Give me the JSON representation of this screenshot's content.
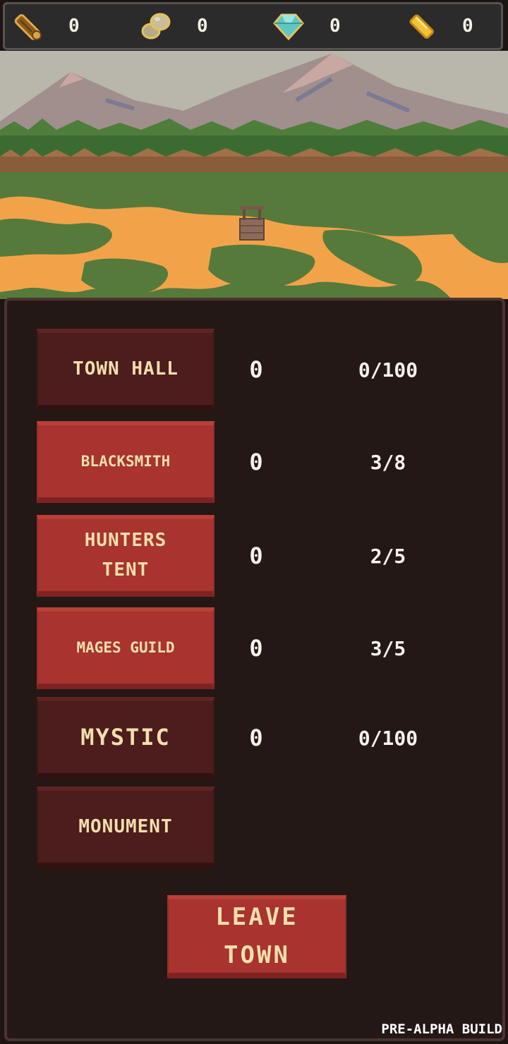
{
  "resources": [
    {
      "name": "wood",
      "icon": "wood-log-icon",
      "count": "0",
      "color": "#b8862a"
    },
    {
      "name": "stone",
      "icon": "stone-icon",
      "count": "0",
      "color": "#c8b88a"
    },
    {
      "name": "gem",
      "icon": "diamond-icon",
      "count": "0",
      "color": "#6fd6d0"
    },
    {
      "name": "gold",
      "icon": "gold-bar-icon",
      "count": "0",
      "color": "#f4c23a"
    }
  ],
  "buildings": [
    {
      "label": "TOWN HALL",
      "level": "0",
      "progress": "0/100",
      "style": "dark"
    },
    {
      "label": "BLACKSMITH",
      "level": "0",
      "progress": "3/8",
      "style": "active"
    },
    {
      "label": "HUNTERS\nTENT",
      "level": "0",
      "progress": "2/5",
      "style": "active"
    },
    {
      "label": "MAGES GUILD",
      "level": "0",
      "progress": "3/5",
      "style": "active"
    },
    {
      "label": "MYSTIC",
      "level": "0",
      "progress": "0/100",
      "style": "dark"
    },
    {
      "label": "MONUMENT",
      "level": "",
      "progress": "",
      "style": "dark"
    }
  ],
  "leave_town": {
    "label": "LEAVE\nTOWN"
  },
  "build_tag": "PRE-ALPHA BUILD",
  "colors": {
    "panel_bg": "#231816",
    "button_active": "#a8332f",
    "button_locked": "#4d1c1c",
    "button_text": "#f2dfad"
  }
}
